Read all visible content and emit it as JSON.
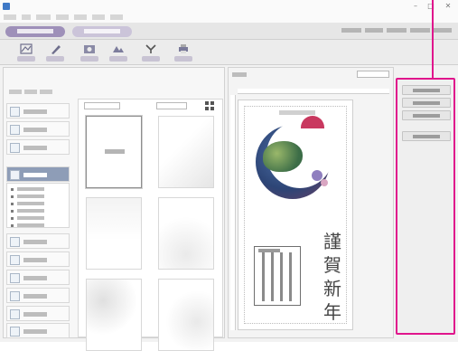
{
  "window": {
    "title": "",
    "controls": {
      "minimize": "–",
      "maximize": "□",
      "close": "✕"
    },
    "menus": []
  },
  "mode_tabs": {
    "items": [
      "",
      ""
    ]
  },
  "top_right_nav": {
    "items": [
      "",
      "",
      "",
      ""
    ]
  },
  "ribbon": {
    "buttons": [
      {
        "name": "layout",
        "label": ""
      },
      {
        "name": "text",
        "label": ""
      },
      {
        "name": "photo",
        "label": ""
      },
      {
        "name": "illustration",
        "label": ""
      },
      {
        "name": "decorate",
        "label": ""
      },
      {
        "name": "print",
        "label": ""
      }
    ]
  },
  "left_pane": {
    "title": "",
    "subtitle": "",
    "categories": [
      "",
      "",
      "",
      "",
      "",
      "",
      "",
      "",
      "",
      "",
      "",
      ""
    ],
    "subcategories": [
      "",
      "",
      "",
      "",
      "",
      ""
    ],
    "thumbnail_selector": "",
    "thumbnail_zoom": "",
    "thumbnails": [
      {
        "caption": ""
      },
      {
        "caption": ""
      },
      {
        "caption": ""
      },
      {
        "caption": ""
      },
      {
        "caption": ""
      },
      {
        "caption": ""
      }
    ]
  },
  "center_pane": {
    "label": "",
    "zoom": "",
    "card": {
      "header": "",
      "calligraphy": [
        "謹",
        "賀",
        "新",
        "年"
      ]
    }
  },
  "right_pane": {
    "buttons": [
      "",
      "",
      "",
      ""
    ]
  },
  "colors": {
    "highlight": "#e0168c",
    "active_tab": "#9e90b9",
    "selected_category": "#8e9db7"
  }
}
